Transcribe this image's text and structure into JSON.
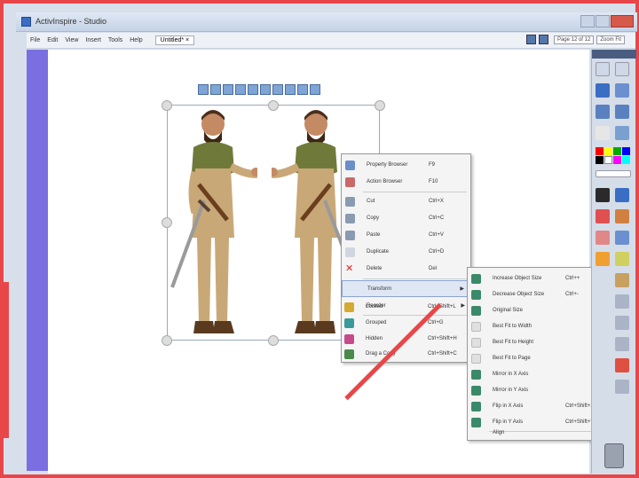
{
  "window": {
    "title": "ActivInspire - Studio"
  },
  "menubar": {
    "items": [
      "File",
      "Edit",
      "View",
      "Insert",
      "Tools",
      "Help"
    ],
    "doc_tab": "Untitled* ×",
    "page_indicator": "Page 12 of 12",
    "zoom": "Zoom Fit"
  },
  "context_menu": {
    "items": [
      {
        "label": "Property Browser",
        "shortcut": "F9",
        "icon": "property-browser-icon"
      },
      {
        "label": "Action Browser",
        "shortcut": "F10",
        "icon": "action-browser-icon"
      },
      {
        "label": "Cut",
        "shortcut": "Ctrl+X",
        "icon": "cut-icon"
      },
      {
        "label": "Copy",
        "shortcut": "Ctrl+C",
        "icon": "copy-icon"
      },
      {
        "label": "Paste",
        "shortcut": "Ctrl+V",
        "icon": "paste-icon"
      },
      {
        "label": "Duplicate",
        "shortcut": "Ctrl+D",
        "icon": "duplicate-icon"
      },
      {
        "label": "Delete",
        "shortcut": "Del",
        "icon": "delete-icon"
      },
      {
        "label": "Transform",
        "shortcut": "",
        "icon": "",
        "submenu": true,
        "highlighted": true
      },
      {
        "label": "Reorder",
        "shortcut": "",
        "icon": "",
        "submenu": true
      },
      {
        "label": "Locked",
        "shortcut": "Ctrl+Shift+L",
        "icon": "lock-icon"
      },
      {
        "label": "Grouped",
        "shortcut": "Ctrl+G",
        "icon": "group-icon"
      },
      {
        "label": "Hidden",
        "shortcut": "Ctrl+Shift+H",
        "icon": "hidden-icon"
      },
      {
        "label": "Drag a Copy",
        "shortcut": "Ctrl+Shift+C",
        "icon": "drag-copy-icon"
      }
    ]
  },
  "transform_menu": {
    "items": [
      {
        "label": "Increase Object Size",
        "shortcut": "Ctrl++",
        "icon": "increase-size-icon"
      },
      {
        "label": "Decrease Object Size",
        "shortcut": "Ctrl+-",
        "icon": "decrease-size-icon"
      },
      {
        "label": "Original Size",
        "shortcut": "",
        "icon": "original-size-icon"
      },
      {
        "label": "Best Fit to Width",
        "shortcut": "",
        "icon": "fit-width-icon"
      },
      {
        "label": "Best Fit to Height",
        "shortcut": "",
        "icon": "fit-height-icon"
      },
      {
        "label": "Best Fit to Page",
        "shortcut": "",
        "icon": "fit-page-icon"
      },
      {
        "label": "Mirror in X Axis",
        "shortcut": "",
        "icon": "mirror-x-icon"
      },
      {
        "label": "Mirror in Y Axis",
        "shortcut": "",
        "icon": "mirror-y-icon"
      },
      {
        "label": "Flip in X Axis",
        "shortcut": "Ctrl+Shift+X",
        "icon": "flip-x-icon"
      },
      {
        "label": "Flip in Y Axis",
        "shortcut": "Ctrl+Shift+Y",
        "icon": "flip-y-icon"
      },
      {
        "label": "Align",
        "shortcut": "",
        "icon": "",
        "submenu": true
      }
    ]
  },
  "colors": {
    "accent": "#3a6ec4",
    "left_strip": "#7a6fe0",
    "annotation_red": "#e8474a",
    "palette": [
      "#ff0000",
      "#ffff00",
      "#00aa00",
      "#0000ff",
      "#000000",
      "#ffffff",
      "#ff00ff",
      "#00ffff"
    ]
  }
}
